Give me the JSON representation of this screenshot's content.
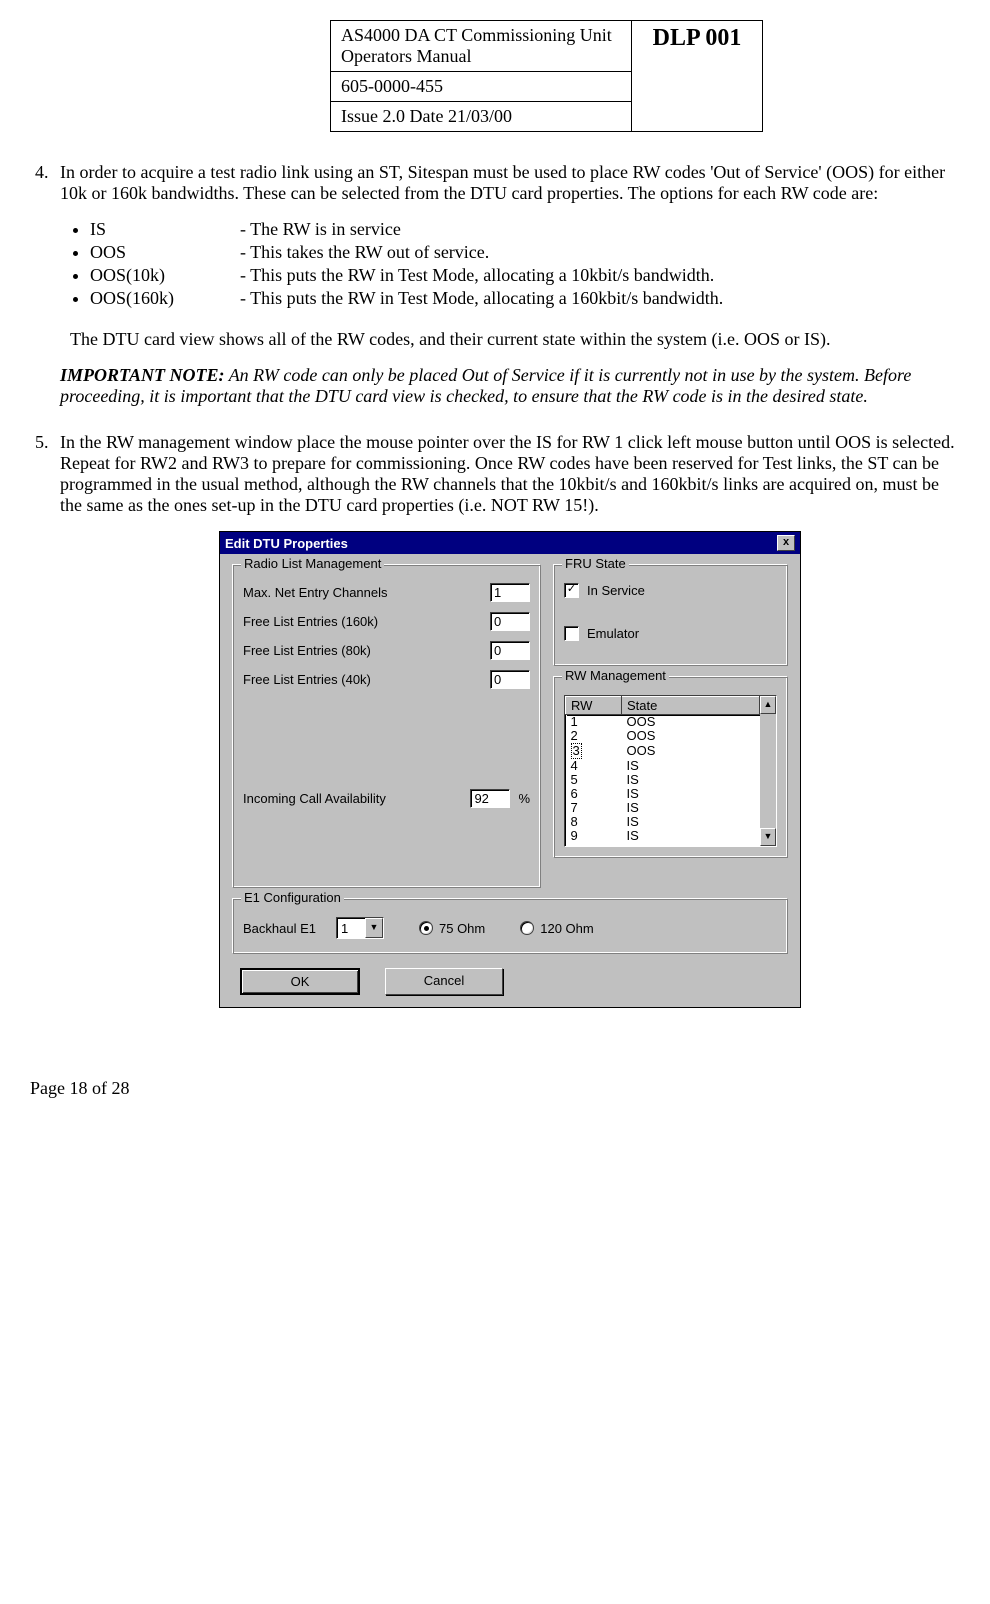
{
  "header": {
    "title_line1": "AS4000 DA CT Commissioning Unit",
    "title_line2": "Operators Manual",
    "doc_no": "605-0000-455",
    "issue": "Issue 2.0  Date 21/03/00",
    "dlp": "DLP 001"
  },
  "step4": {
    "num": "4.",
    "text": "In order to acquire a test radio link using an ST, Sitespan must be used to place RW codes 'Out of Service' (OOS) for either 10k or 160k bandwidths. These can be selected from the DTU card properties. The options for each RW code are:",
    "bullets": [
      {
        "term": "IS",
        "desc": "- The RW is in service"
      },
      {
        "term": "OOS",
        "desc": "- This takes the RW out of service."
      },
      {
        "term": "OOS(10k)",
        "desc": "- This puts the RW in Test Mode, allocating a 10kbit/s bandwidth."
      },
      {
        "term": "OOS(160k)",
        "desc": "- This puts the RW in Test Mode, allocating a 160kbit/s bandwidth."
      }
    ],
    "after": "The DTU card view shows all of the RW codes, and their current state within the system (i.e. OOS or IS).",
    "note_label": "IMPORTANT NOTE:",
    "note_text": " An RW code can only be placed Out of Service if it is currently not in use by the system. Before proceeding, it is important that the DTU card view is checked, to ensure that the RW code is in the desired state."
  },
  "step5": {
    "num": "5.",
    "text": "In the RW management window place the mouse pointer over the IS for RW 1 click left mouse button until OOS is selected. Repeat for RW2 and RW3 to prepare for commissioning.  Once RW codes have been reserved for Test links, the ST can be programmed in the usual method, although the RW channels that the 10kbit/s and 160kbit/s links are acquired on, must be the same as the ones set-up in the DTU card properties (i.e. NOT RW 15!)."
  },
  "dialog": {
    "title": "Edit DTU Properties",
    "close": "x",
    "radio_list_mgmt": {
      "legend": "Radio List Management",
      "max_net_entry_label": "Max. Net Entry Channels",
      "max_net_entry_val": "1",
      "free160_label": "Free List Entries (160k)",
      "free160_val": "0",
      "free80_label": "Free List Entries (80k)",
      "free80_val": "0",
      "free40_label": "Free List Entries (40k)",
      "free40_val": "0",
      "incoming_label": "Incoming Call Availability",
      "incoming_val": "92",
      "pct": "%"
    },
    "fru_state": {
      "legend": "FRU State",
      "in_service_label": "In Service",
      "in_service_checked": "✓",
      "emulator_label": "Emulator"
    },
    "rw_mgmt": {
      "legend": "RW Management",
      "col_rw": "RW",
      "col_state": "State",
      "rows": [
        {
          "rw": "1",
          "state": "OOS"
        },
        {
          "rw": "2",
          "state": "OOS"
        },
        {
          "rw": "3",
          "state": "OOS"
        },
        {
          "rw": "4",
          "state": "IS"
        },
        {
          "rw": "5",
          "state": "IS"
        },
        {
          "rw": "6",
          "state": "IS"
        },
        {
          "rw": "7",
          "state": "IS"
        },
        {
          "rw": "8",
          "state": "IS"
        },
        {
          "rw": "9",
          "state": "IS"
        }
      ],
      "up": "▲",
      "down": "▼"
    },
    "e1": {
      "legend": "E1 Configuration",
      "backhaul_label": "Backhaul E1",
      "backhaul_val": "1",
      "combo_arrow": "▼",
      "ohm75": "75 Ohm",
      "ohm120": "120 Ohm"
    },
    "buttons": {
      "ok": "OK",
      "cancel": "Cancel"
    }
  },
  "footer": "Page 18 of 28"
}
